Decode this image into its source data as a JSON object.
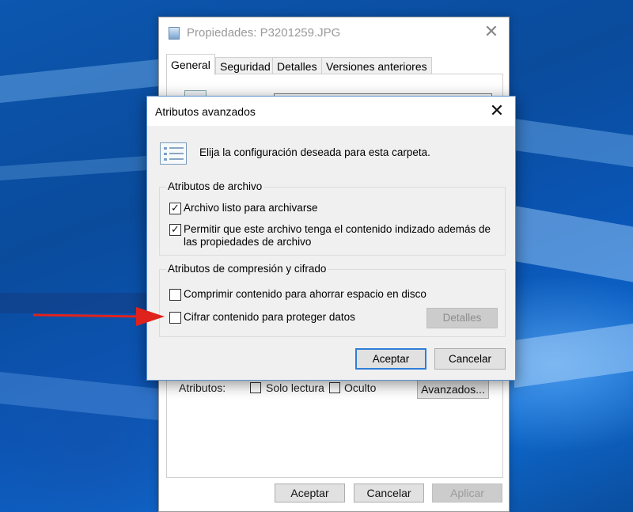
{
  "props_window": {
    "title": "Propiedades: P3201259.JPG",
    "tabs": [
      {
        "label": "General",
        "active": true
      },
      {
        "label": "Seguridad",
        "active": false
      },
      {
        "label": "Detalles",
        "active": false
      },
      {
        "label": "Versiones anteriores",
        "active": false
      }
    ],
    "attributes_label": "Atributos:",
    "readonly_label": "Solo lectura",
    "readonly_checked": false,
    "hidden_label": "Oculto",
    "hidden_checked": false,
    "advanced_button": "Avanzados...",
    "ok_button": "Aceptar",
    "cancel_button": "Cancelar",
    "apply_button": "Aplicar"
  },
  "dialog": {
    "title": "Atributos avanzados",
    "message": "Elija la configuración deseada para esta carpeta.",
    "file_group": {
      "legend": "Atributos de archivo",
      "archive_label": "Archivo listo para archivarse",
      "archive_checked": true,
      "index_label": "Permitir que este archivo tenga el contenido indizado además de las propiedades de archivo",
      "index_checked": true
    },
    "compress_group": {
      "legend": "Atributos de compresión y cifrado",
      "compress_label": "Comprimir contenido para ahorrar espacio en disco",
      "compress_checked": false,
      "encrypt_label": "Cifrar contenido para proteger datos",
      "encrypt_checked": false,
      "details_button": "Detalles"
    },
    "ok_button": "Aceptar",
    "cancel_button": "Cancelar"
  },
  "colors": {
    "desktop": "#0b4f9e",
    "arrow": "#e0221c",
    "focus_border": "#2f7ed8"
  },
  "icons": {
    "close": "close-icon",
    "file": "image-file-icon",
    "settings": "attributes-list-icon",
    "check": "checkmark-icon",
    "arrow": "red-arrow-icon"
  }
}
